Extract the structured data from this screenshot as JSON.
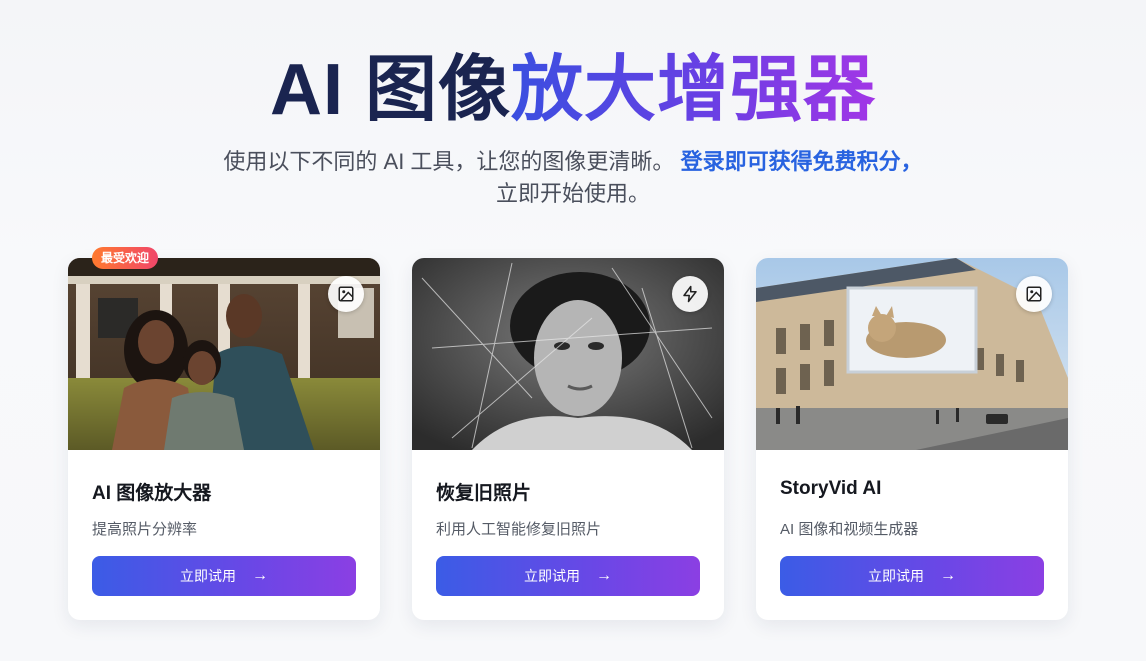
{
  "hero": {
    "title_dark": "AI 图像",
    "title_gradient": "放大增强器",
    "subtitle_line1": "使用以下不同的 AI 工具，让您的图像更清晰。",
    "subtitle_highlight": "登录即可获得免费积分，",
    "subtitle_line2": "立即开始使用。"
  },
  "badge": {
    "label": "最受欢迎"
  },
  "cards": [
    {
      "title": "AI 图像放大器",
      "desc": "提高照片分辨率",
      "button": "立即试用",
      "icon": "image-icon"
    },
    {
      "title": "恢复旧照片",
      "desc": "利用人工智能修复旧照片",
      "button": "立即试用",
      "icon": "lightning-icon"
    },
    {
      "title": "StoryVid AI",
      "desc": "AI 图像和视频生成器",
      "button": "立即试用",
      "icon": "image-icon"
    }
  ],
  "colors": {
    "title_dark": "#1a2450",
    "accent_blue": "#2863e0",
    "gradient_start": "#3b5ce6",
    "gradient_end": "#8b3fe3",
    "badge_start": "#ff7a2e",
    "badge_end": "#f0466a"
  }
}
